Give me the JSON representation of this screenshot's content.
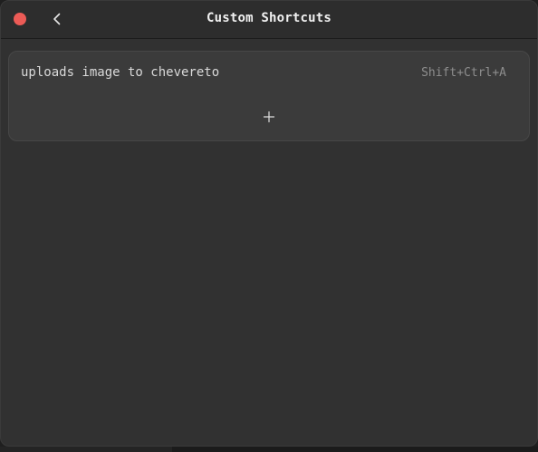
{
  "window": {
    "title": "Custom Shortcuts"
  },
  "icons": {
    "close": "close-icon",
    "back": "chevron-left-icon",
    "add": "plus-icon"
  },
  "shortcuts": [
    {
      "name": "uploads image to chevereto",
      "keys": "Shift+Ctrl+A"
    }
  ],
  "colors": {
    "close_button": "#ec5b56",
    "background": "#313131",
    "card": "#3b3b3b"
  }
}
